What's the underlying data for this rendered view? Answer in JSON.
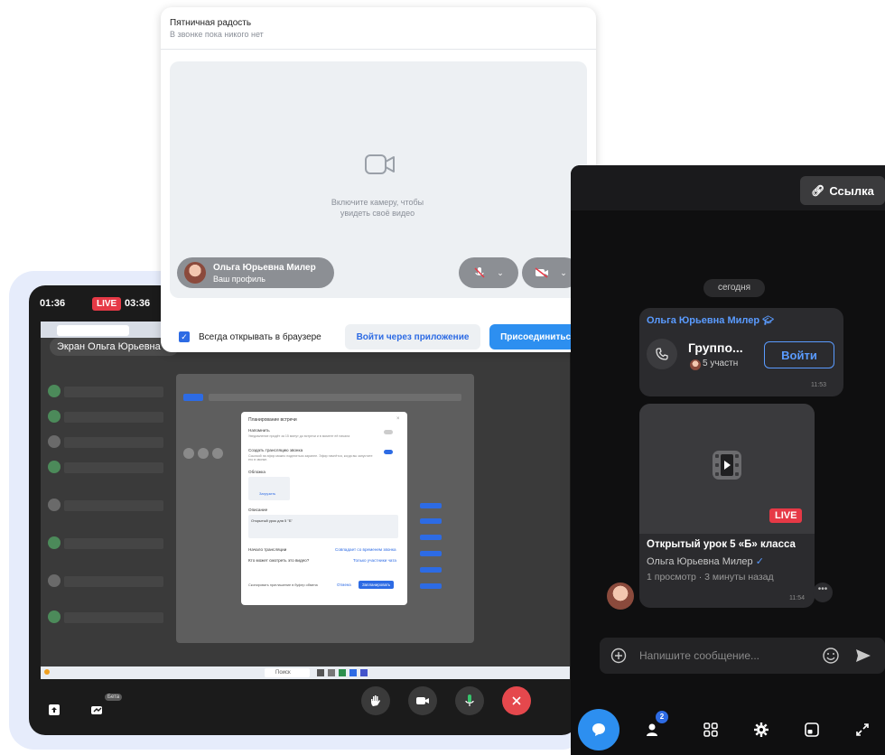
{
  "join_panel": {
    "title": "Пятничная радость",
    "subtitle": "В звонке пока никого нет",
    "camera_hint_1": "Включите камеру, чтобы",
    "camera_hint_2": "увидеть своё видео",
    "self_name": "Ольга Юрьевна Милер",
    "self_subtitle": "Ваш профиль",
    "always_browser_label": "Всегда открывать в браузере",
    "app_button": "Войти через приложение",
    "join_button": "Присоединиться"
  },
  "device": {
    "clock": "01:36",
    "live_label": "LIVE",
    "live_duration": "03:36",
    "share_chip": "Экран Ольга Юрьевна М",
    "beta_badge": "Бета",
    "inner_dialog": {
      "title": "Планирование встречи",
      "remind_label": "Напомнить",
      "remind_sub": "Уведомление придёт за 15 минут до встречи и в момент её начала",
      "stream_label": "Создать трансляцию звонка",
      "stream_sub": "Ссылкой на эфир можно поделиться заранее. Эфир начнётся, когда вы запустите его в звонке.",
      "cover_label": "Обложка",
      "upload_label": "Загрузить",
      "description_label": "Описание",
      "description_value": "Открытый урок для 5 \"Б\"",
      "start_label": "Начало трансляции",
      "start_value": "Совпадает со временем звонка",
      "who_label": "Кто может смотреть это видео?",
      "who_value": "Только участники чата",
      "copy_label": "Скопировать приглашение в буфер обмена",
      "cancel_label": "Отмена",
      "schedule_label": "Запланировать"
    },
    "taskbar_search": "Поиск"
  },
  "chat": {
    "link_button": "Ссылка",
    "date_label": "сегодня",
    "call_message": {
      "author": "Ольга Юрьевна Милер",
      "title": "Группо...",
      "members": "5 участн",
      "join_button": "Войти",
      "time": "11:53"
    },
    "video_message": {
      "live_label": "LIVE",
      "title": "Открытый урок 5 «Б» класса",
      "author": "Ольга Юрьевна Милер",
      "stats": "1 просмотр · 3 минуты назад",
      "time": "11:54"
    },
    "input_placeholder": "Напишите сообщение...",
    "nav_badge": "2"
  },
  "colors": {
    "accent_blue": "#2d6be4",
    "link_blue": "#5a9bff",
    "live_red": "#e63946",
    "chat_bg": "#0f0f10"
  }
}
